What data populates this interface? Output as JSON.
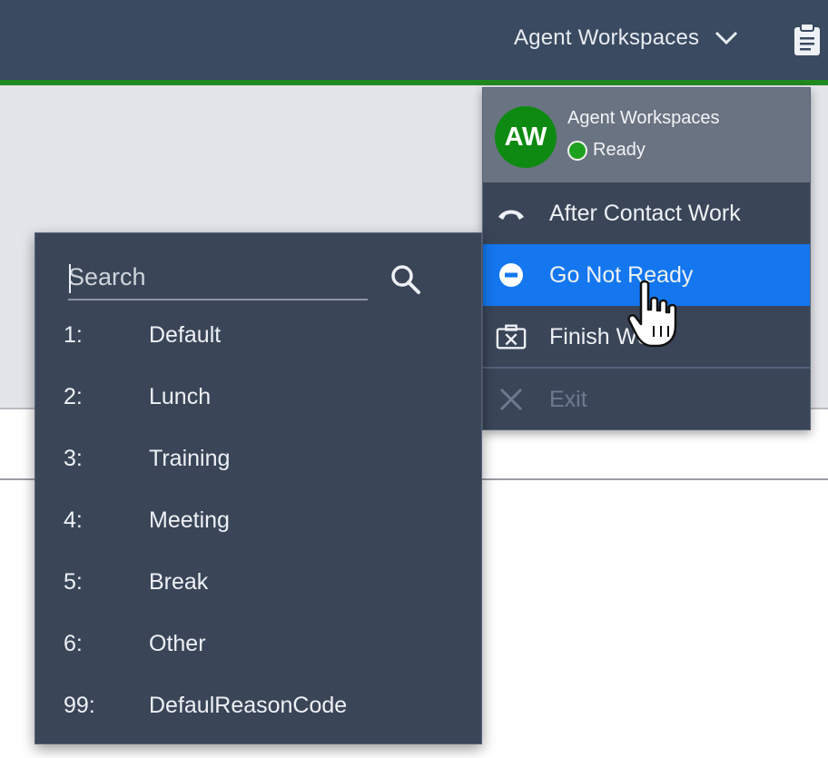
{
  "header": {
    "workspace_label": "Agent Workspaces"
  },
  "agent_menu": {
    "avatar_initials": "AW",
    "agent_name": "Agent Workspaces",
    "status": "Ready",
    "items": [
      {
        "label": "After Contact Work",
        "icon": "phone-hangup-icon"
      },
      {
        "label": "Go Not Ready",
        "icon": "minus-circle-icon",
        "highlighted": true
      },
      {
        "label": "Finish Work",
        "icon": "close-box-icon"
      },
      {
        "label": "Exit",
        "icon": "close-icon",
        "disabled": true
      }
    ]
  },
  "reason_panel": {
    "search_placeholder": "Search",
    "reasons": [
      {
        "code": "1:",
        "label": "Default"
      },
      {
        "code": "2:",
        "label": "Lunch"
      },
      {
        "code": "3:",
        "label": "Training"
      },
      {
        "code": "4:",
        "label": "Meeting"
      },
      {
        "code": "5:",
        "label": "Break"
      },
      {
        "code": "6:",
        "label": "Other"
      },
      {
        "code": "99:",
        "label": "DefaulReasonCode"
      }
    ]
  },
  "colors": {
    "topbar": "#3a4a61",
    "accent_green": "#1f8a1f",
    "menu_bg": "#3a4558",
    "highlight_blue": "#1477f0",
    "avatar_green": "#0e8a12"
  }
}
